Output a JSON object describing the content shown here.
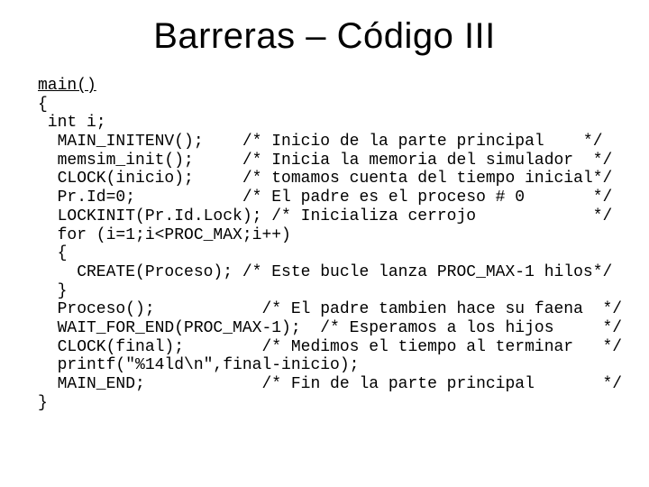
{
  "title": "Barreras – Código III",
  "code": {
    "fn": "main()",
    "lines": [
      "{",
      " int i;",
      "  MAIN_INITENV();    /* Inicio de la parte principal    */",
      "  memsim_init();     /* Inicia la memoria del simulador  */",
      "  CLOCK(inicio);     /* tomamos cuenta del tiempo inicial*/",
      "  Pr.Id=0;           /* El padre es el proceso # 0       */",
      "  LOCKINIT(Pr.Id.Lock); /* Inicializa cerrojo            */",
      "  for (i=1;i<PROC_MAX;i++)",
      "  {",
      "    CREATE(Proceso); /* Este bucle lanza PROC_MAX-1 hilos*/",
      "  }",
      "  Proceso();           /* El padre tambien hace su faena  */",
      "  WAIT_FOR_END(PROC_MAX-1);  /* Esperamos a los hijos     */",
      "  CLOCK(final);        /* Medimos el tiempo al terminar   */",
      "  printf(\"%14ld\\n\",final-inicio);",
      "  MAIN_END;            /* Fin de la parte principal       */",
      "}"
    ]
  }
}
